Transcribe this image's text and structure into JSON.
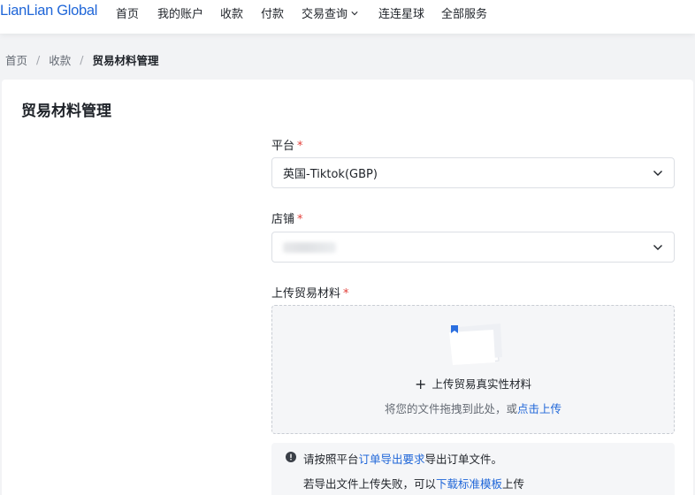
{
  "brand": {
    "logo_text": "LianLian Global",
    "accent": "#1f66d8",
    "required_color": "#e2403a"
  },
  "nav": {
    "items": [
      {
        "label": "首页"
      },
      {
        "label": "我的账户"
      },
      {
        "label": "收款"
      },
      {
        "label": "付款"
      },
      {
        "label": "交易查询",
        "has_dropdown": true
      },
      {
        "label": "连连星球"
      },
      {
        "label": "全部服务"
      }
    ]
  },
  "breadcrumb": {
    "home": "首页",
    "parent": "收款",
    "current": "贸易材料管理",
    "separator": "/"
  },
  "page": {
    "title": "贸易材料管理"
  },
  "form": {
    "required_mark": "*",
    "platform": {
      "label": "平台",
      "value": "英国-Tiktok(GBP)"
    },
    "store": {
      "label": "店铺",
      "value_redacted": true
    },
    "upload": {
      "label": "上传贸易材料",
      "plus": "+",
      "title": "上传贸易真实性材料",
      "hint_prefix": "将您的文件拖拽到此处，或",
      "hint_link": "点击上传"
    }
  },
  "notice": {
    "line1_prefix": "请按照平台",
    "line1_link": "订单导出要求",
    "line1_suffix": "导出订单文件。",
    "line2_prefix": "若导出文件上传失败，可以",
    "line2_link": "下载标准模板",
    "line2_suffix": "上传"
  }
}
